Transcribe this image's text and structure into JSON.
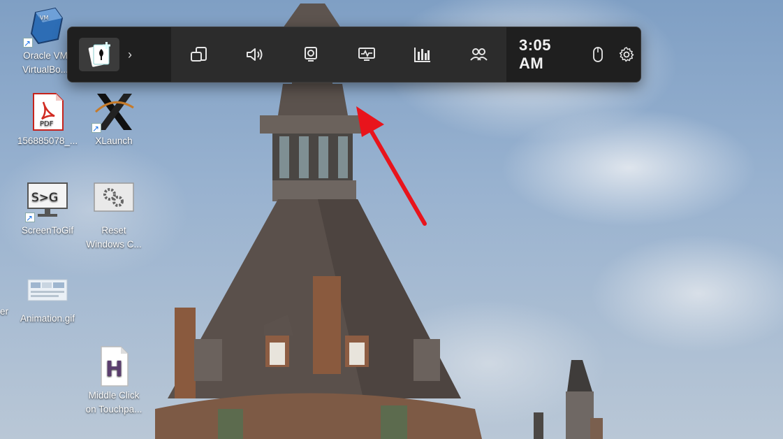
{
  "desktop": {
    "icons": [
      {
        "label_line1": "Oracle VM",
        "label_line2": "VirtualBo..."
      },
      {
        "label_line1": "156885078_..."
      },
      {
        "label_line1": "XLaunch"
      },
      {
        "label_line1": "ScreenToGif"
      },
      {
        "label_line1": "Reset",
        "label_line2": "Windows C..."
      },
      {
        "label_line1": "Animation.gif"
      },
      {
        "label_line1": "Middle Click",
        "label_line2": "on Touchpa..."
      }
    ],
    "left_fragments": [
      "er"
    ],
    "pdf_badge": "PDF",
    "screentogif_glyph": "S>G",
    "middle_click_glyph": "H"
  },
  "gamebar": {
    "clock": "3:05 AM",
    "buttons": [
      {
        "icon": "widget-menu-icon"
      },
      {
        "icon": "audio-icon"
      },
      {
        "icon": "capture-icon"
      },
      {
        "icon": "performance-icon"
      },
      {
        "icon": "resources-icon"
      },
      {
        "icon": "xbox-social-icon"
      }
    ],
    "right_icons": [
      "mouse-icon",
      "gear-icon"
    ]
  },
  "annotation": {
    "color": "#e8141c"
  }
}
